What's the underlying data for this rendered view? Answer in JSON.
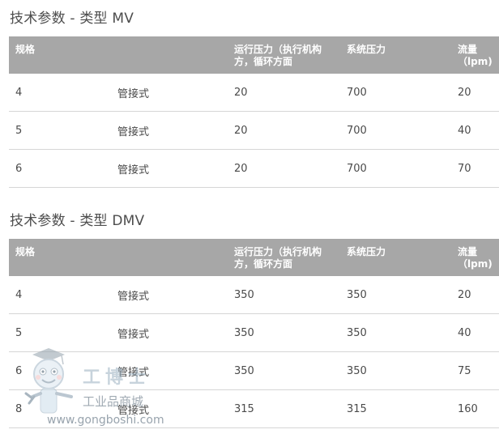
{
  "sections": [
    {
      "title": "技术参数 - 类型 MV",
      "headers": [
        "规格",
        "",
        "运行压力（执行机构方，循环方面",
        "系统压力",
        "流量（lpm)"
      ],
      "rows": [
        [
          "4",
          "管接式",
          "20",
          "700",
          "20"
        ],
        [
          "5",
          "管接式",
          "20",
          "700",
          "40"
        ],
        [
          "6",
          "管接式",
          "20",
          "700",
          "70"
        ]
      ]
    },
    {
      "title": "技术参数 - 类型 DMV",
      "headers": [
        "规格",
        "",
        "运行压力（执行机构方，循环方面",
        "系统压力",
        "流量（lpm)"
      ],
      "rows": [
        [
          "4",
          "管接式",
          "350",
          "350",
          "20"
        ],
        [
          "5",
          "管接式",
          "350",
          "350",
          "40"
        ],
        [
          "6",
          "管接式",
          "350",
          "350",
          "75"
        ],
        [
          "8",
          "管接式",
          "315",
          "315",
          "160"
        ]
      ]
    }
  ],
  "watermark": {
    "brand": "工博士",
    "subtitle": "工业品商城",
    "url": "www.gongboshi.com"
  }
}
